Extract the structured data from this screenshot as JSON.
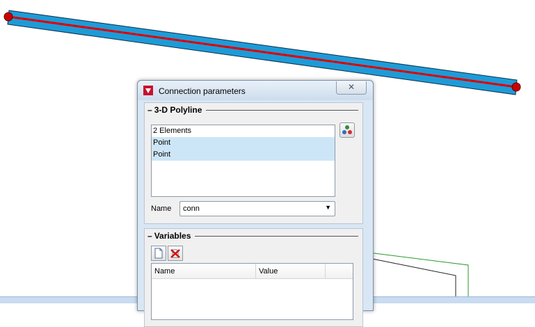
{
  "dialog": {
    "title": "Connection parameters",
    "close_label": "✕",
    "polyline_group": {
      "title": "3-D Polyline",
      "list_items": [
        {
          "label": "2 Elements",
          "selected": false
        },
        {
          "label": "Point",
          "selected": true
        },
        {
          "label": "Point",
          "selected": true
        }
      ],
      "name_label": "Name",
      "name_value": "conn"
    },
    "variables_group": {
      "title": "Variables",
      "columns": [
        "Name",
        "Value"
      ]
    }
  },
  "colors": {
    "beam_fill": "#1e9bd7",
    "beam_axis": "#e00000",
    "endpoint": "#cc0000",
    "dialog_bg": "#d9e6f3"
  }
}
